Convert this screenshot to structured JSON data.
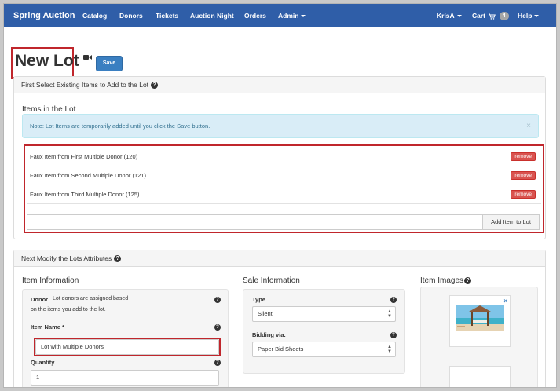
{
  "navbar": {
    "brand": "Spring Auction",
    "items": [
      "Catalog",
      "Donors",
      "Tickets",
      "Auction Night",
      "Orders"
    ],
    "admin": "Admin",
    "user": "KrisA",
    "cart": "Cart",
    "cart_count": "4",
    "help": "Help",
    "help_glyph": "?"
  },
  "page": {
    "title": "New Lot",
    "save_label": "Save"
  },
  "items_panel": {
    "heading": "First Select Existing Items to Add to the Lot",
    "help_glyph": "?",
    "section_title": "Items in the Lot",
    "note": "Note: Lot Items are temporarily added until you click the Save button.",
    "close_glyph": "×",
    "items": [
      "Faux Item from First Multiple Donor (120)",
      "Faux Item from Second Multiple Donor (121)",
      "Faux Item from Third Multiple Donor (125)"
    ],
    "remove_label": "remove",
    "add_value": "",
    "add_label": "Add Item to Lot"
  },
  "attributes_panel": {
    "heading": "Next Modify the Lots Attributes",
    "help_glyph": "?",
    "item_info": {
      "title": "Item Information",
      "donor_label": "Donor",
      "donor_text_1": "Lot donors are assigned based",
      "donor_text_2": "on the items you add to the lot.",
      "name_label": "Item Name *",
      "name_value": "Lot with Multiple Donors",
      "quantity_label": "Quantity",
      "quantity_value": "1"
    },
    "sale_info": {
      "title": "Sale Information",
      "type_label": "Type",
      "type_value": "Silent",
      "bidding_label": "Bidding via:",
      "bidding_value": "Paper Bid Sheets"
    },
    "images": {
      "title": "Item Images",
      "remove_glyph": "×"
    }
  },
  "colors": {
    "navbar": "#2f5ea8",
    "highlight": "#c0262c",
    "remove": "#d9534f",
    "save": "#3a7fc1",
    "alert_bg": "#d9edf7"
  },
  "icons": [
    "video-camera-icon",
    "cart-icon",
    "help-icon",
    "close-icon",
    "select-arrows-icon"
  ]
}
